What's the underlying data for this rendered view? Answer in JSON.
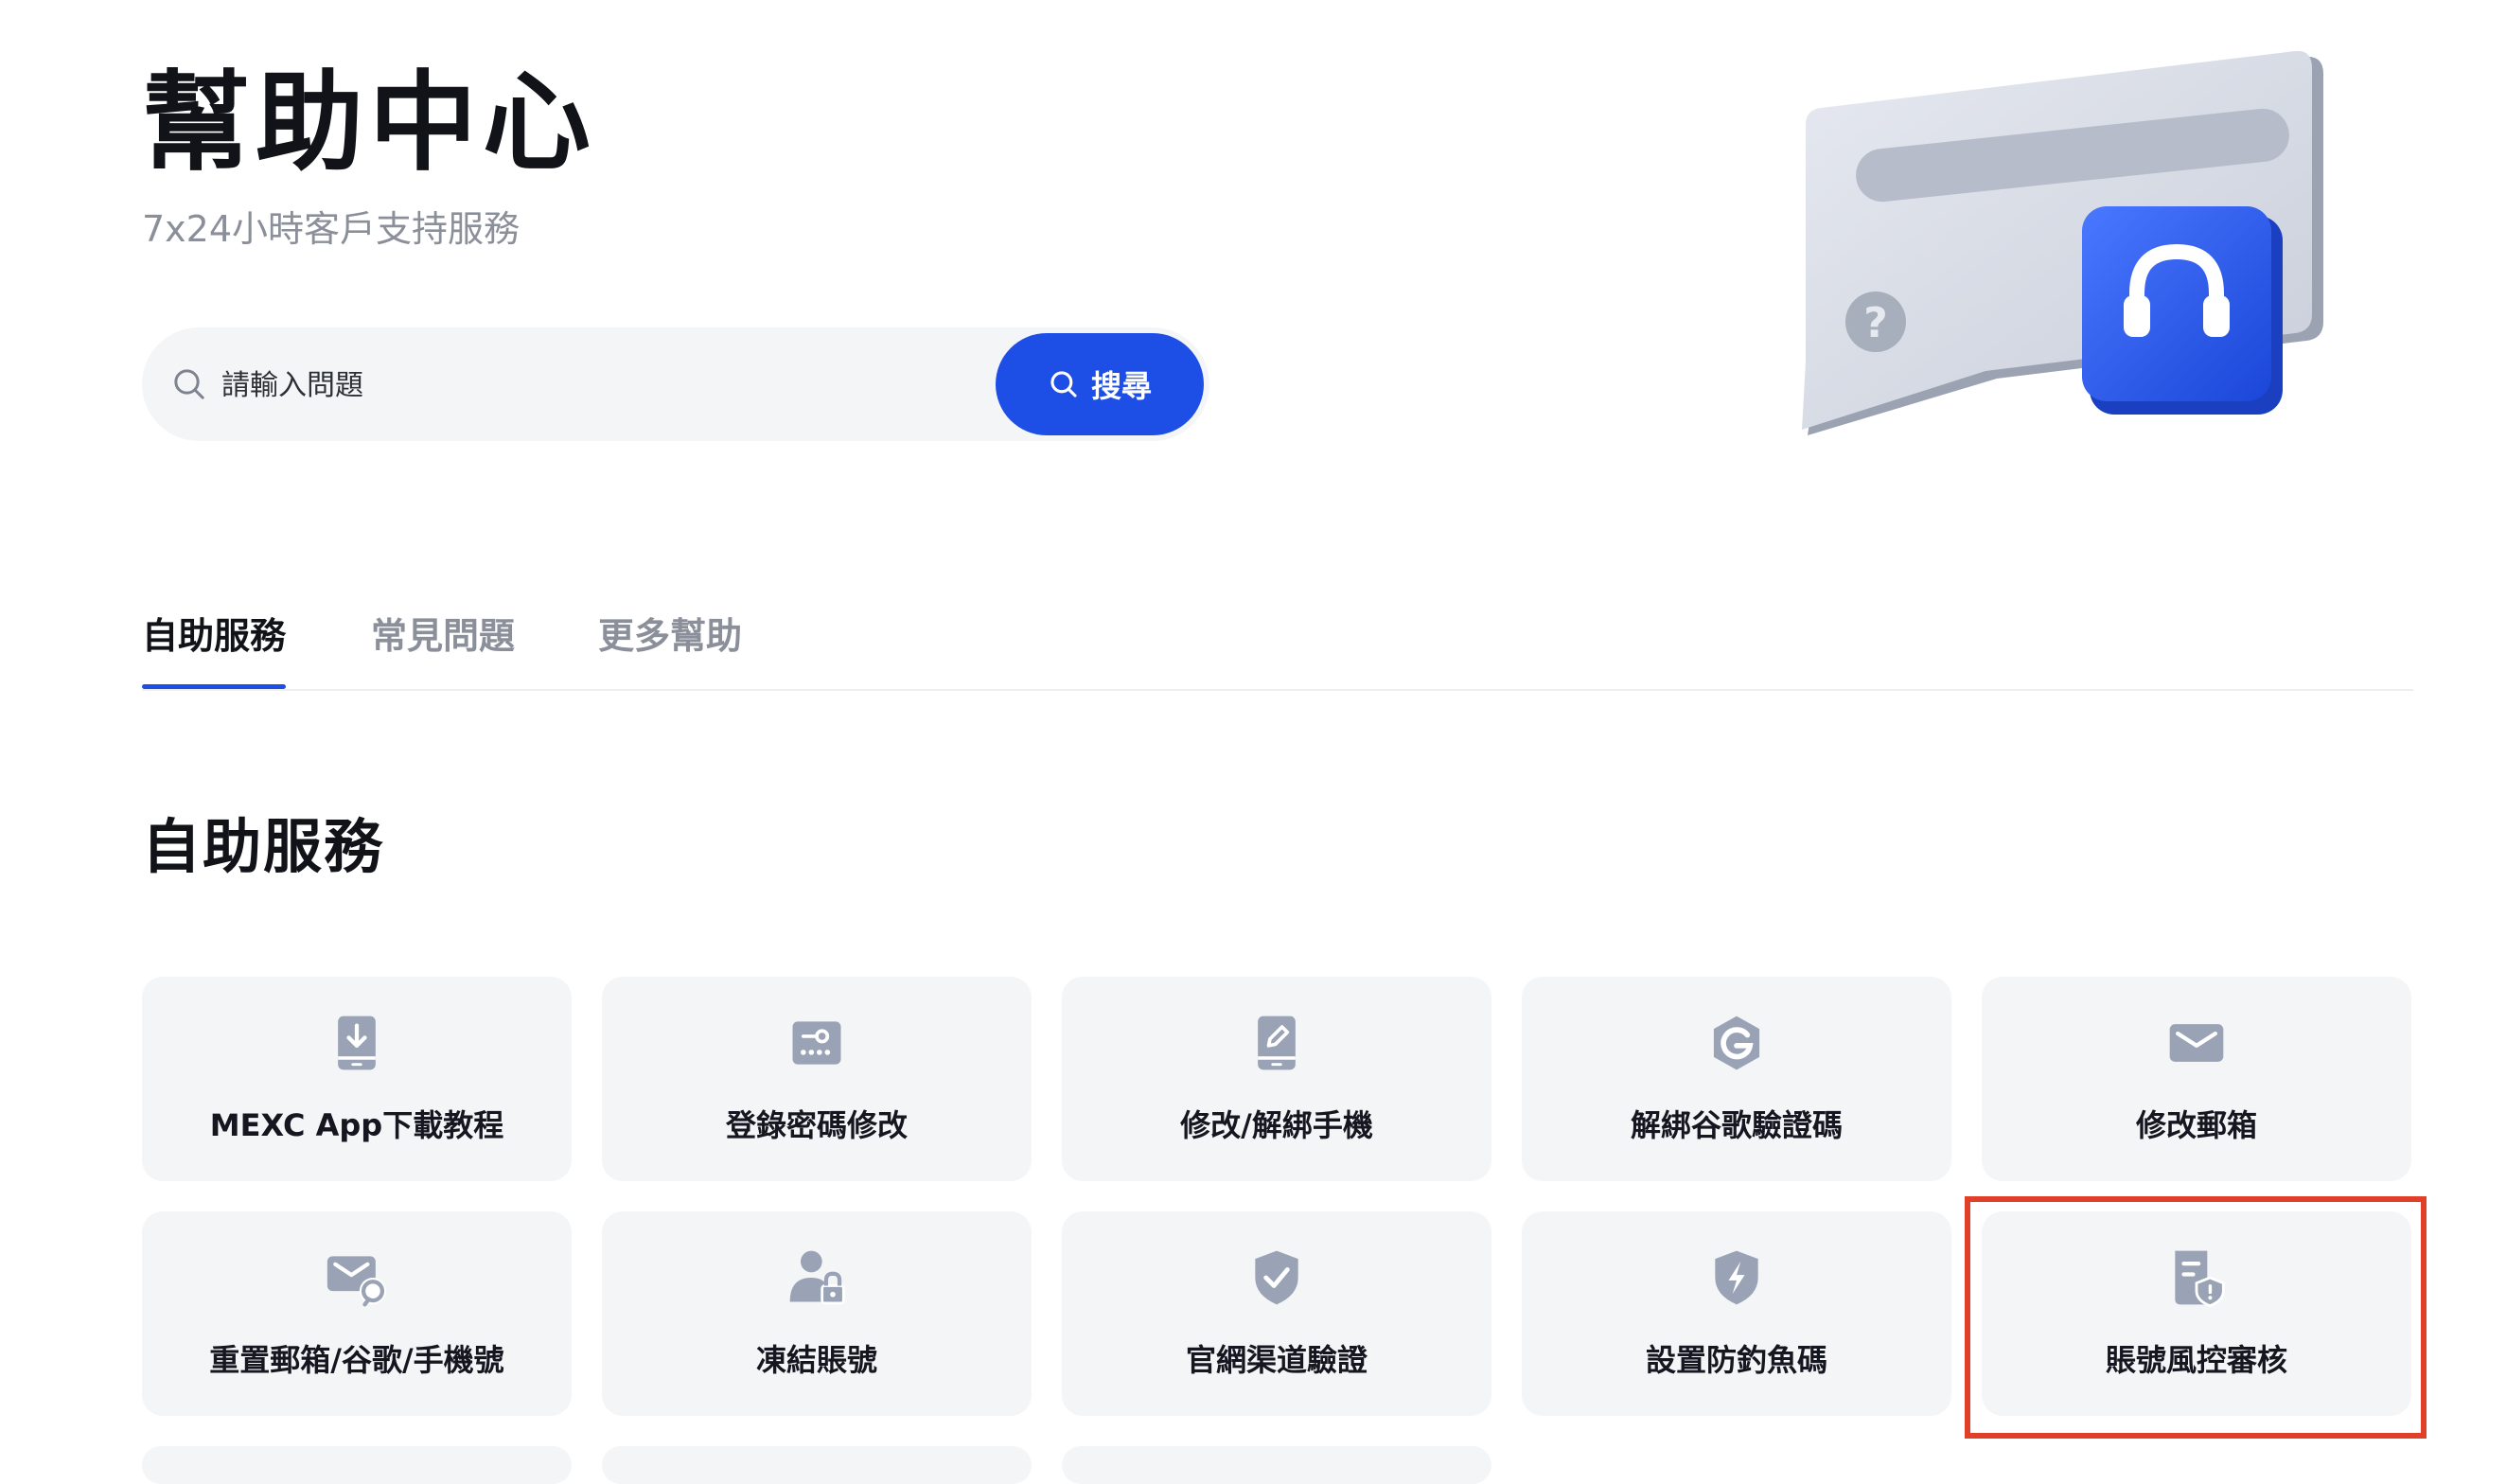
{
  "header": {
    "title": "幫助中心",
    "subtitle": "7x24小時客戶支持服務"
  },
  "search": {
    "placeholder": "請輸入問題",
    "button_label": "搜尋",
    "icon": "search-icon"
  },
  "hero": {
    "icon": "headset-chat-illustration"
  },
  "tabs": [
    {
      "label": "自助服務",
      "active": true
    },
    {
      "label": "常見問題",
      "active": false
    },
    {
      "label": "更多幫助",
      "active": false
    }
  ],
  "section": {
    "title": "自助服務"
  },
  "services": [
    {
      "label": "MEXC App下載教程",
      "icon": "app-download-icon"
    },
    {
      "label": "登錄密碼修改",
      "icon": "password-key-icon"
    },
    {
      "label": "修改/解綁手機",
      "icon": "phone-edit-icon"
    },
    {
      "label": "解綁谷歌驗證碼",
      "icon": "google-icon"
    },
    {
      "label": "修改郵箱",
      "icon": "mail-icon"
    },
    {
      "label": "重置郵箱/谷歌/手機號",
      "icon": "mail-reset-icon"
    },
    {
      "label": "凍結賬號",
      "icon": "user-lock-icon"
    },
    {
      "label": "官網渠道驗證",
      "icon": "shield-check-icon"
    },
    {
      "label": "設置防釣魚碼",
      "icon": "shield-bolt-icon"
    },
    {
      "label": "賬號風控審核",
      "icon": "document-alert-icon",
      "highlighted": true
    }
  ],
  "colors": {
    "accent": "#1d4ee6",
    "card_bg": "#f4f5f7",
    "icon_gray": "#9aa3b5",
    "highlight": "#e0402a"
  }
}
